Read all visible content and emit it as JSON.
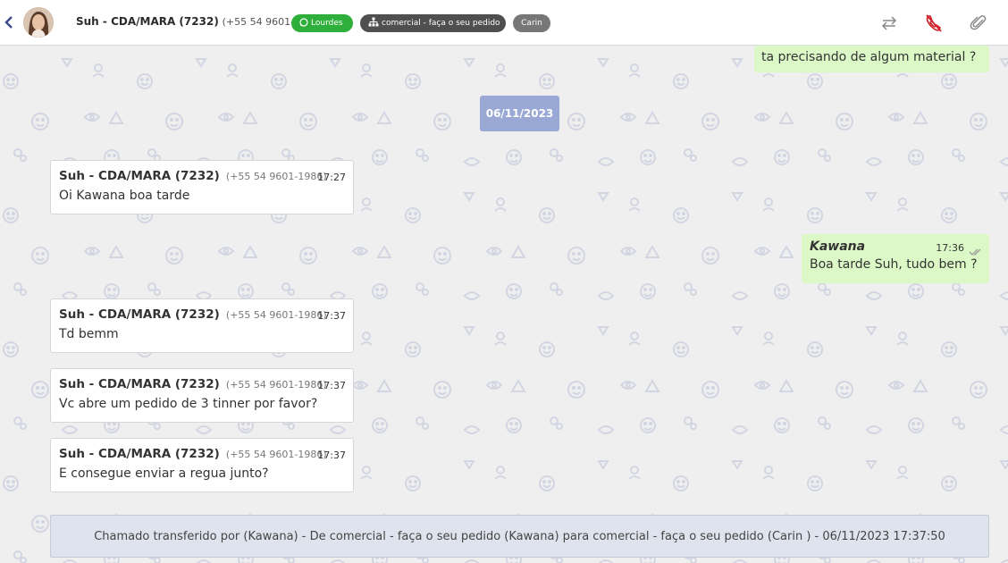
{
  "header": {
    "contact_name": "Suh - CDA/MARA (7232)",
    "contact_phone": "(+55 54 9601-1986)",
    "tags": [
      {
        "label": "Lourdes",
        "icon": "whatsapp-icon",
        "color": "#2eae3a"
      },
      {
        "label": "comercial - faça o seu pedido",
        "icon": "sitemap-icon",
        "color": "#4f4f4f"
      },
      {
        "label": "Carin",
        "color": "#777777"
      }
    ],
    "actions": [
      "transfer-icon",
      "end-call-icon",
      "attach-icon"
    ]
  },
  "chat": {
    "top_partial_message": "ta precisando de algum material ?",
    "date_separator": "06/11/2023",
    "messages": [
      {
        "direction": "in",
        "sender": "Suh - CDA/MARA (7232)",
        "phone": "(+55 54 9601-1986)",
        "time": "17:27",
        "text": "Oi Kawana boa tarde"
      },
      {
        "direction": "out",
        "sender": "Kawana",
        "time": "17:36",
        "text": "Boa tarde Suh, tudo bem ?",
        "status": "read"
      },
      {
        "direction": "in",
        "sender": "Suh - CDA/MARA (7232)",
        "phone": "(+55 54 9601-1986)",
        "time": "17:37",
        "text": "Td bemm"
      },
      {
        "direction": "in",
        "sender": "Suh - CDA/MARA (7232)",
        "phone": "(+55 54 9601-1986)",
        "time": "17:37",
        "text": "Vc abre um pedido de 3 tinner por favor?"
      },
      {
        "direction": "in",
        "sender": "Suh - CDA/MARA (7232)",
        "phone": "(+55 54 9601-1986)",
        "time": "17:37",
        "text": "E consegue enviar a regua junto?"
      }
    ],
    "system_notice": "Chamado transferido por (Kawana) - De comercial - faça o seu pedido (Kawana) para comercial - faça o seu pedido (Carin ) - 06/11/2023 17:37:50"
  },
  "colors": {
    "accent_red": "#d0202a",
    "outgoing_bubble": "#dcf8c6",
    "date_chip": "#9aa8d6",
    "notice_bg": "#dfe3ee"
  }
}
